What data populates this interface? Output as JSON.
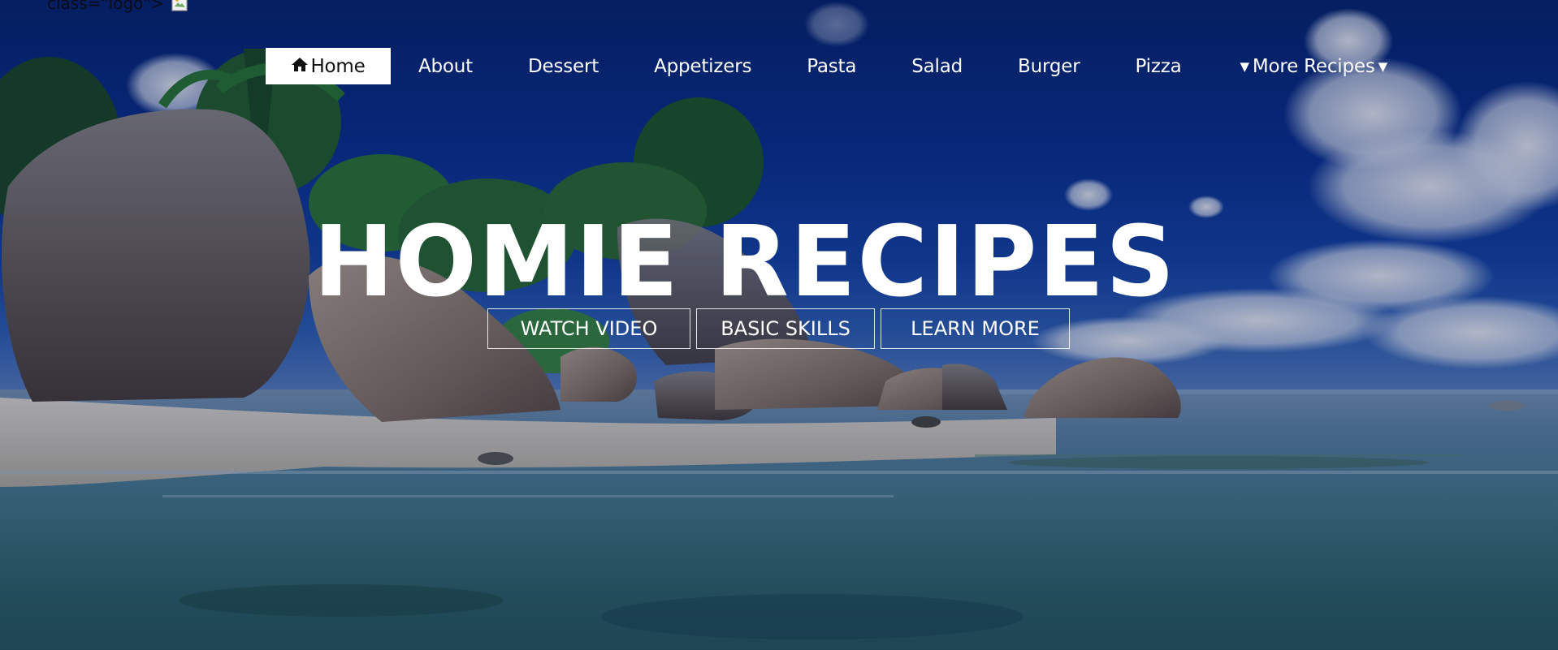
{
  "logo": {
    "broken_text": "class=\"logo\">",
    "broken_image_icon": "broken-image-icon"
  },
  "nav": {
    "home_label": "Home",
    "home_icon": "home-icon",
    "items": [
      "About",
      "Dessert",
      "Appetizers",
      "Pasta",
      "Salad",
      "Burger",
      "Pizza"
    ],
    "more_label": "More Recipes",
    "more_icon": "caret-down-icon"
  },
  "hero": {
    "title": "HOMIE RECIPES",
    "buttons": [
      "WATCH VIDEO",
      "BASIC SKILLS",
      "LEARN MORE"
    ]
  },
  "colors": {
    "text": "#ffffff",
    "active_nav_bg": "#ffffff",
    "active_nav_text": "#111111",
    "sky": "#0a3190",
    "sea": "#4b7f8f"
  }
}
